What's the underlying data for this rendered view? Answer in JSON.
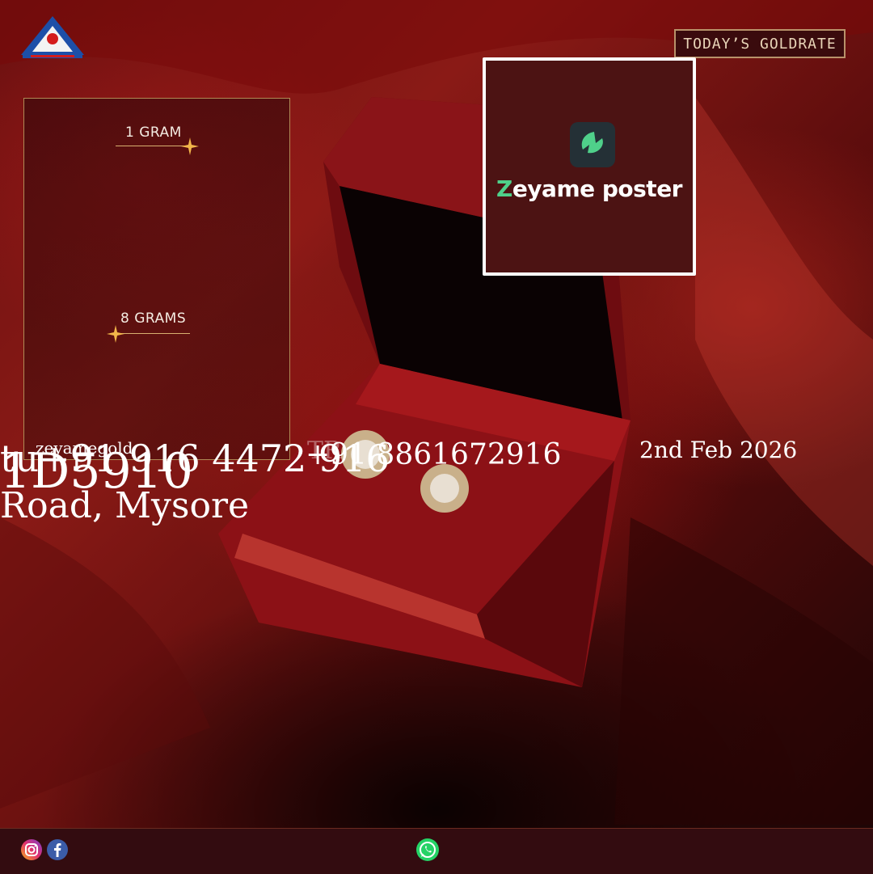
{
  "header": {
    "rate_button_label": "TODAY’S GOLDRATE"
  },
  "promo": {
    "brand_first_letter": "Z",
    "brand_rest": "eyame poster"
  },
  "rates_panel": {
    "items": [
      {
        "label": "1 GRAM"
      },
      {
        "label": "8 GRAMS"
      }
    ]
  },
  "contact": {
    "handle": "zeyamegold",
    "phone_line": "tu+91 916 4472 916",
    "phone_alt": "+91 8861672916",
    "ghost_text": "TR",
    "big_number": "1D5910",
    "address": "Road, Mysore",
    "date": "2nd Feb 2026"
  },
  "colors": {
    "accent_gold": "#d8b070",
    "footer_bg": "#330c10",
    "promo_bg": "#4c1313",
    "whatsapp": "#25d366",
    "facebook": "#3b5ca8"
  },
  "icons": {
    "top_logo": "bis-hallmark-logo-icon",
    "promo_logo": "zeyame-leaf-icon",
    "sparkle": "sparkle-icon",
    "footer": [
      "instagram-icon",
      "facebook-icon",
      "whatsapp-icon"
    ]
  }
}
